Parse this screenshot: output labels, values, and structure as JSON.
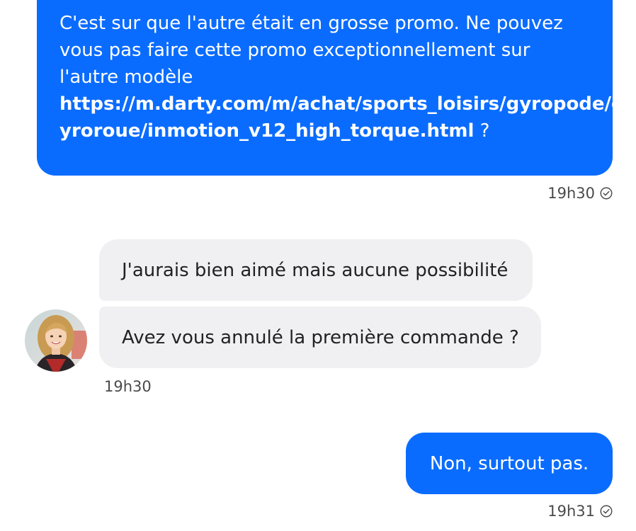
{
  "conversation": {
    "messages": [
      {
        "from": "me",
        "lines": [
          "C'est sur que l'autre était en grosse promo. Ne pouvez",
          "vous pas faire cette promo exceptionnellement sur",
          "l'autre modèle"
        ],
        "link_part1": "https://m.darty.com/m/achat/sports_loisirs/gyropode/g",
        "link_part2": "yroroue/inmotion_v12_high_torque.html",
        "link_suffix": " ?",
        "time": "19h30"
      },
      {
        "from": "agent",
        "text": "J'aurais bien aimé mais aucune possibilité"
      },
      {
        "from": "agent",
        "text": "Avez vous annulé la première commande ?",
        "time": "19h30"
      },
      {
        "from": "me",
        "text": "Non, surtout pas.",
        "time": "19h31"
      }
    ]
  },
  "colors": {
    "outgoing_bubble": "#0a6cff",
    "incoming_bubble": "#f0f0f2",
    "timestamp_text": "#4a4a4a"
  },
  "icons": {
    "read_receipt": "check-circle-icon",
    "agent_avatar": "agent-avatar-photo"
  }
}
